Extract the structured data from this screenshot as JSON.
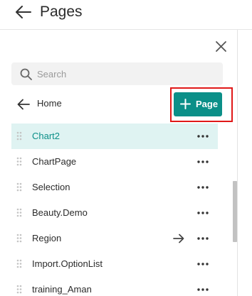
{
  "header": {
    "title": "Pages"
  },
  "search": {
    "placeholder": "Search",
    "value": ""
  },
  "nav": {
    "title": "Home"
  },
  "add_page": {
    "label": "Page"
  },
  "colors": {
    "accent": "#0b8f88",
    "selected_bg": "#dff3f2",
    "highlight": "#e01818"
  },
  "icons": {
    "back": "arrow-left-icon",
    "close": "close-icon",
    "search": "search-icon",
    "plus": "plus-icon",
    "drag": "drag-handle-icon",
    "more": "more-horizontal-icon",
    "go": "arrow-right-icon"
  },
  "pages": [
    {
      "name": "Chart2",
      "selected": true
    },
    {
      "name": "ChartPage",
      "selected": false
    },
    {
      "name": "Selection",
      "selected": false
    },
    {
      "name": "Beauty.Demo",
      "selected": false
    },
    {
      "name": "Region",
      "selected": false,
      "has_arrow": true
    },
    {
      "name": "Import.OptionList",
      "selected": false
    },
    {
      "name": "training_Aman",
      "selected": false
    }
  ]
}
